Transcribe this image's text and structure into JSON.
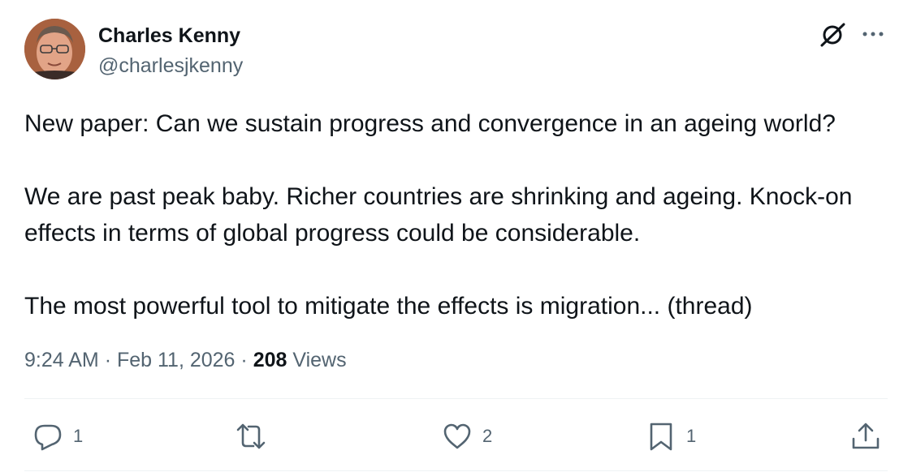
{
  "author": {
    "display_name": "Charles Kenny",
    "handle": "@charlesjkenny"
  },
  "tweet": {
    "paragraphs": [
      "New paper: Can we sustain progress and convergence in an ageing world?",
      "We are past peak baby. Richer countries are shrinking and ageing. Knock-on effects in terms of global progress could be considerable.",
      "The most powerful tool to mitigate the effects is migration... (thread)"
    ],
    "time": "9:24 AM",
    "date": "Feb 11, 2026",
    "separator": "·",
    "views_count": "208",
    "views_label": "Views"
  },
  "actions": {
    "reply_count": "1",
    "like_count": "2",
    "bookmark_count": "1"
  },
  "icons": {
    "header": [
      "grok-icon",
      "more-options-icon"
    ],
    "actions": [
      "reply-icon",
      "retweet-icon",
      "like-icon",
      "bookmark-icon",
      "share-icon"
    ]
  },
  "colors": {
    "text": "#0f1419",
    "secondary": "#536471",
    "divider": "#eff3f4"
  }
}
